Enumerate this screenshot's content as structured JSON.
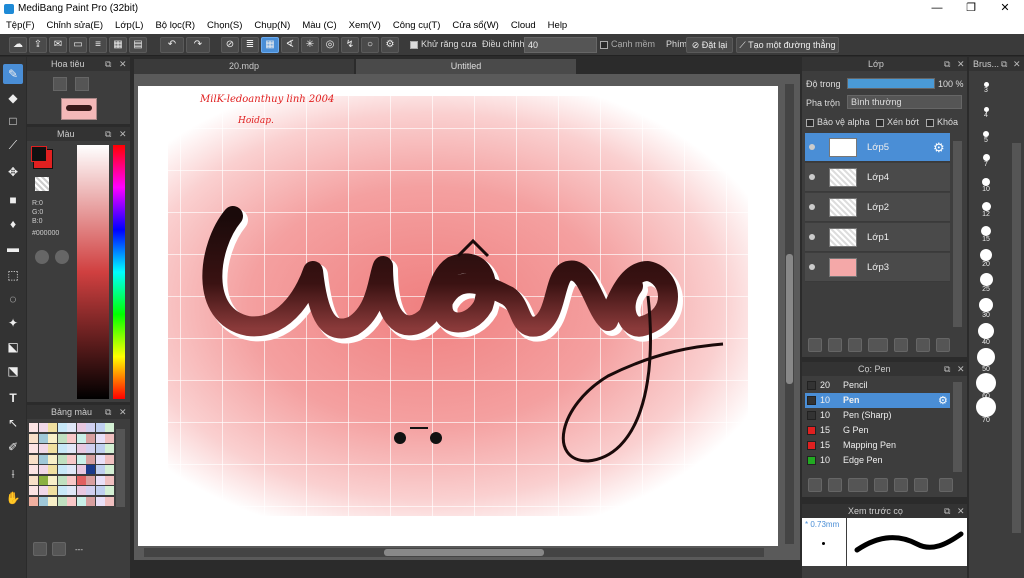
{
  "window": {
    "title": "MediBang Paint Pro (32bit)",
    "minimize": "—",
    "maximize": "❐",
    "close": "✕"
  },
  "menu": [
    "Tệp(F)",
    "Chỉnh sửa(E)",
    "Lớp(L)",
    "Bộ lọc(R)",
    "Chọn(S)",
    "Chụp(N)",
    "Màu (C)",
    "Xem(V)",
    "Công cụ(T)",
    "Cửa sổ(W)",
    "Cloud",
    "Help"
  ],
  "toolbar": {
    "antialias_label": "Khử răng cưa",
    "adjust_label": "Điều chỉnh",
    "adjust_value": "40",
    "edge_label": "Cạnh mềm",
    "shortcut_label": "Phím",
    "set_label": "Đặt lại",
    "create_line_label": "Tạo một đường thẳng"
  },
  "tabs": {
    "tab1": "20.mdp",
    "tab2": "Untitled"
  },
  "navigator": {
    "title": "Hoa tiêu"
  },
  "color": {
    "title": "Màu",
    "r": "R:0",
    "g": "G:0",
    "b": "B:0",
    "hex": "#000000"
  },
  "palette": {
    "title": "Bảng màu",
    "footer": "---"
  },
  "canvas": {
    "signature_line1": "MilK-ledoanthuy linh 2004",
    "signature_line2": "Hoidap."
  },
  "layers": {
    "title": "Lớp",
    "opacity_label": "Độ trong",
    "opacity_value": "100 %",
    "opacity": 1.0,
    "blend_label": "Pha trộn",
    "blend_value": "Bình thường",
    "protect_alpha": "Bảo vệ alpha",
    "clipping": "Xén bớt",
    "lock": "Khóa",
    "items": [
      {
        "name": "Lớp5"
      },
      {
        "name": "Lớp4"
      },
      {
        "name": "Lớp2"
      },
      {
        "name": "Lớp1"
      },
      {
        "name": "Lớp3"
      }
    ]
  },
  "brushes": {
    "title": "Cọ: Pen",
    "items": [
      {
        "size": "20",
        "name": "Pencil",
        "color": "#333333"
      },
      {
        "size": "10",
        "name": "Pen",
        "color": "#333333"
      },
      {
        "size": "10",
        "name": "Pen (Sharp)",
        "color": "#333333"
      },
      {
        "size": "15",
        "name": "G Pen",
        "color": "#e02020"
      },
      {
        "size": "15",
        "name": "Mapping Pen",
        "color": "#e02020"
      },
      {
        "size": "10",
        "name": "Edge Pen",
        "color": "#22aa22"
      }
    ]
  },
  "preview": {
    "title": "Xem trước cọ",
    "size": "* 0.73mm"
  },
  "brush_size": {
    "title": "Brus...",
    "sizes": [
      "3",
      "4",
      "5",
      "7",
      "10",
      "12",
      "15",
      "20",
      "25",
      "30",
      "40",
      "50",
      "60",
      "70"
    ]
  },
  "colors": {
    "accent": "#4a8ed6",
    "panel": "#3d3d3d",
    "canvas_bg": "#ffffff"
  }
}
